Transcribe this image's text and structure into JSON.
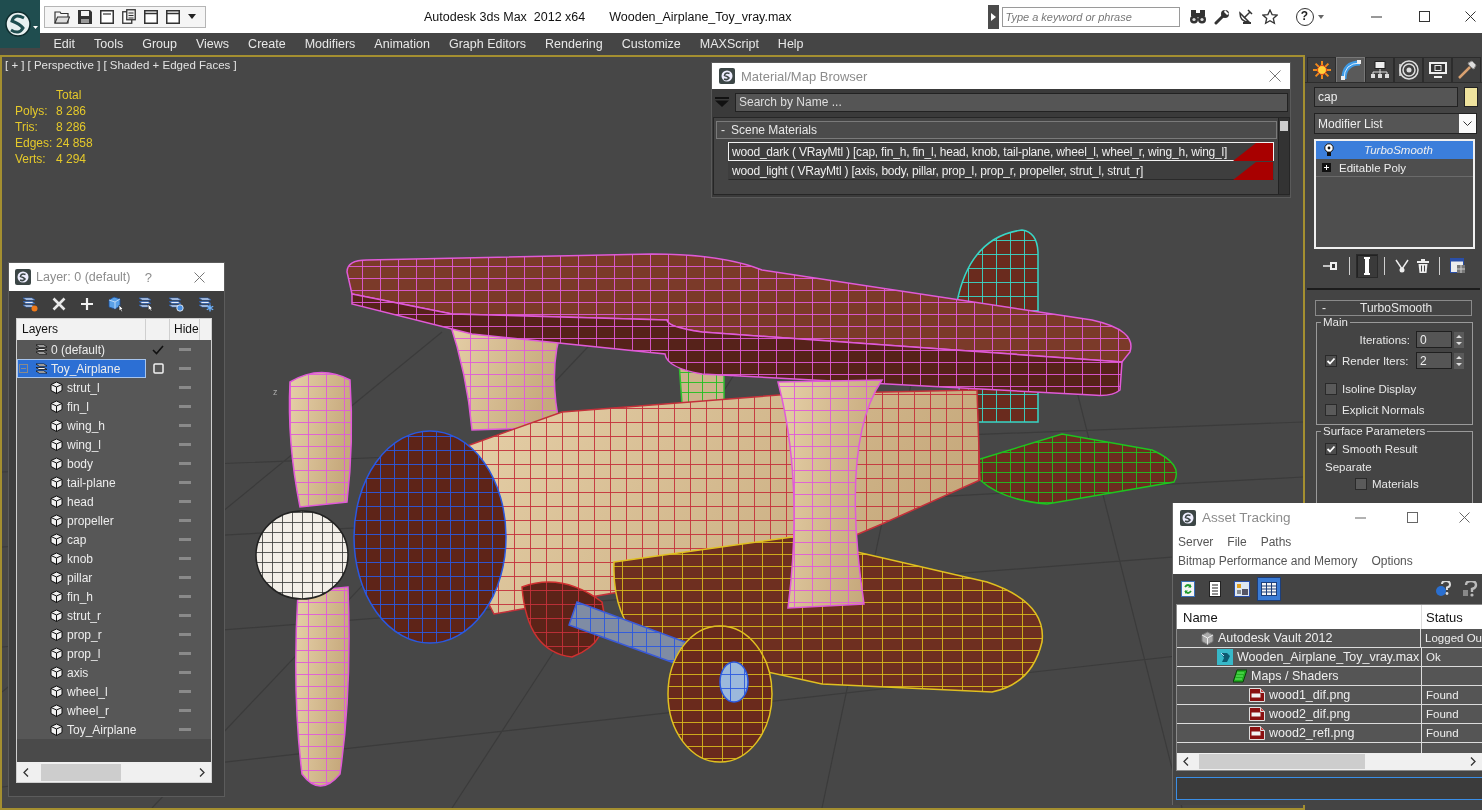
{
  "title_bar": {
    "app_title": "Autodesk 3ds Max  2012 x64",
    "file_name": "Wooden_Airplane_Toy_vray.max",
    "search": {
      "placeholder": "Type a keyword or phrase"
    },
    "help": "?"
  },
  "menu_bar": [
    "Edit",
    "Tools",
    "Group",
    "Views",
    "Create",
    "Modifiers",
    "Animation",
    "Graph Editors",
    "Rendering",
    "Customize",
    "MAXScript",
    "Help"
  ],
  "viewport": {
    "labels": [
      "[ + ]",
      "[ Perspective ]",
      "[ Shaded + Edged Faces ]"
    ],
    "stats": {
      "heading": "Total",
      "rows": [
        {
          "label": "Polys:",
          "value": "8 286"
        },
        {
          "label": "Tris:",
          "value": "8 286"
        },
        {
          "label": "Edges:",
          "value": "24 858"
        },
        {
          "label": "Verts:",
          "value": "4 294"
        }
      ]
    },
    "axis_label": "z"
  },
  "material_browser": {
    "title": "Material/Map Browser",
    "search": {
      "placeholder": "Search by Name ..."
    },
    "group": {
      "toggle": "-",
      "label": "Scene Materials"
    },
    "materials": [
      {
        "label": "wood_dark ( VRayMtl ) [cap, fin_h, fin_l, head, knob, tail-plane, wheel_l, wheel_r, wing_h, wing_l]",
        "selected": true
      },
      {
        "label": "wood_light ( VRayMtl ) [axis, body, pillar, prop_l, prop_r, propeller, strut_l, strut_r]",
        "selected": false
      }
    ]
  },
  "layer_dialog": {
    "title": "Layer: 0 (default)",
    "help": "?",
    "columns": [
      "Layers",
      "Hide"
    ],
    "layers": [
      {
        "name": "0 (default)",
        "current": true,
        "selected": false
      },
      {
        "name": "Toy_Airplane",
        "current": false,
        "selected": true,
        "expanded": true,
        "children": [
          {
            "name": "strut_l",
            "selected": false
          },
          {
            "name": "fin_l",
            "selected": false
          },
          {
            "name": "wing_h",
            "selected": false
          },
          {
            "name": "wing_l",
            "selected": false
          },
          {
            "name": "body",
            "selected": false
          },
          {
            "name": "tail-plane",
            "selected": false
          },
          {
            "name": "head",
            "selected": false
          },
          {
            "name": "propeller",
            "selected": false
          },
          {
            "name": "cap",
            "selected": false
          },
          {
            "name": "knob",
            "selected": false
          },
          {
            "name": "pillar",
            "selected": false
          },
          {
            "name": "fin_h",
            "selected": false
          },
          {
            "name": "strut_r",
            "selected": false
          },
          {
            "name": "prop_r",
            "selected": false
          },
          {
            "name": "prop_l",
            "selected": false
          },
          {
            "name": "axis",
            "selected": false
          },
          {
            "name": "wheel_l",
            "selected": false
          },
          {
            "name": "wheel_r",
            "selected": false
          },
          {
            "name": "Toy_Airplane",
            "selected": false
          }
        ]
      }
    ]
  },
  "command_panel": {
    "tabs": [
      {
        "kind": "create",
        "selected": false
      },
      {
        "kind": "modify",
        "selected": true
      },
      {
        "kind": "hierarchy",
        "selected": false
      },
      {
        "kind": "motion",
        "selected": false
      },
      {
        "kind": "display",
        "selected": false
      },
      {
        "kind": "utilities",
        "selected": false
      }
    ],
    "object_name": "cap",
    "modifier_list": "Modifier List",
    "modifier_stack": [
      {
        "name": "TurboSmooth",
        "kind": "modifier",
        "on": true,
        "selected": true
      },
      {
        "name": "Editable Poly",
        "kind": "base",
        "expanded": false,
        "selected": false
      }
    ],
    "stack_tools": [
      {
        "kind": "pin",
        "on": false
      },
      {
        "kind": "end-result",
        "on": true
      },
      {
        "kind": "make-unique",
        "on": false
      },
      {
        "kind": "remove",
        "on": false
      },
      {
        "kind": "configure",
        "on": false
      }
    ],
    "rollout": {
      "toggle": "-",
      "title": "TurboSmooth",
      "groups": [
        {
          "title": "Main",
          "controls": [
            {
              "kind": "spinner",
              "label": "Iterations:",
              "value": "0"
            },
            {
              "kind": "check-spinner",
              "label": "Render Iters:",
              "value": "2",
              "checked": true
            },
            {
              "kind": "checkbox",
              "label": "Isoline Display",
              "checked": false
            },
            {
              "kind": "checkbox",
              "label": "Explicit Normals",
              "checked": false
            }
          ]
        },
        {
          "title": "Surface Parameters",
          "controls": [
            {
              "kind": "checkbox",
              "label": "Smooth Result",
              "checked": true
            },
            {
              "kind": "heading",
              "label": "Separate"
            },
            {
              "kind": "sub-checkbox",
              "label": "Materials",
              "checked": false
            }
          ]
        }
      ]
    }
  },
  "asset_tracking": {
    "title": "Asset Tracking",
    "menu_rows": [
      [
        "Server",
        "File",
        "Paths"
      ],
      [
        "Bitmap Performance and Memory",
        "Options"
      ]
    ],
    "toolbar": [
      {
        "kind": "refresh",
        "selected": false
      },
      {
        "kind": "list",
        "selected": false
      },
      {
        "kind": "thumbnails",
        "selected": false
      },
      {
        "kind": "table",
        "selected": true
      }
    ],
    "columns": [
      "Name",
      "Status"
    ],
    "assets": [
      {
        "name": "Autodesk Vault 2012",
        "status": "Logged Ou",
        "kind": "vault",
        "children": [
          {
            "name": "Wooden_Airplane_Toy_vray.max",
            "status": "Ok",
            "kind": "scene",
            "children": [
              {
                "name": "Maps / Shaders",
                "kind": "maps",
                "children": [
                  {
                    "name": "wood1_dif.png",
                    "status": "Found",
                    "kind": "image"
                  },
                  {
                    "name": "wood2_dif.png",
                    "status": "Found",
                    "kind": "image"
                  },
                  {
                    "name": "wood2_refl.png",
                    "status": "Found",
                    "kind": "image"
                  }
                ]
              }
            ]
          }
        ]
      }
    ]
  }
}
